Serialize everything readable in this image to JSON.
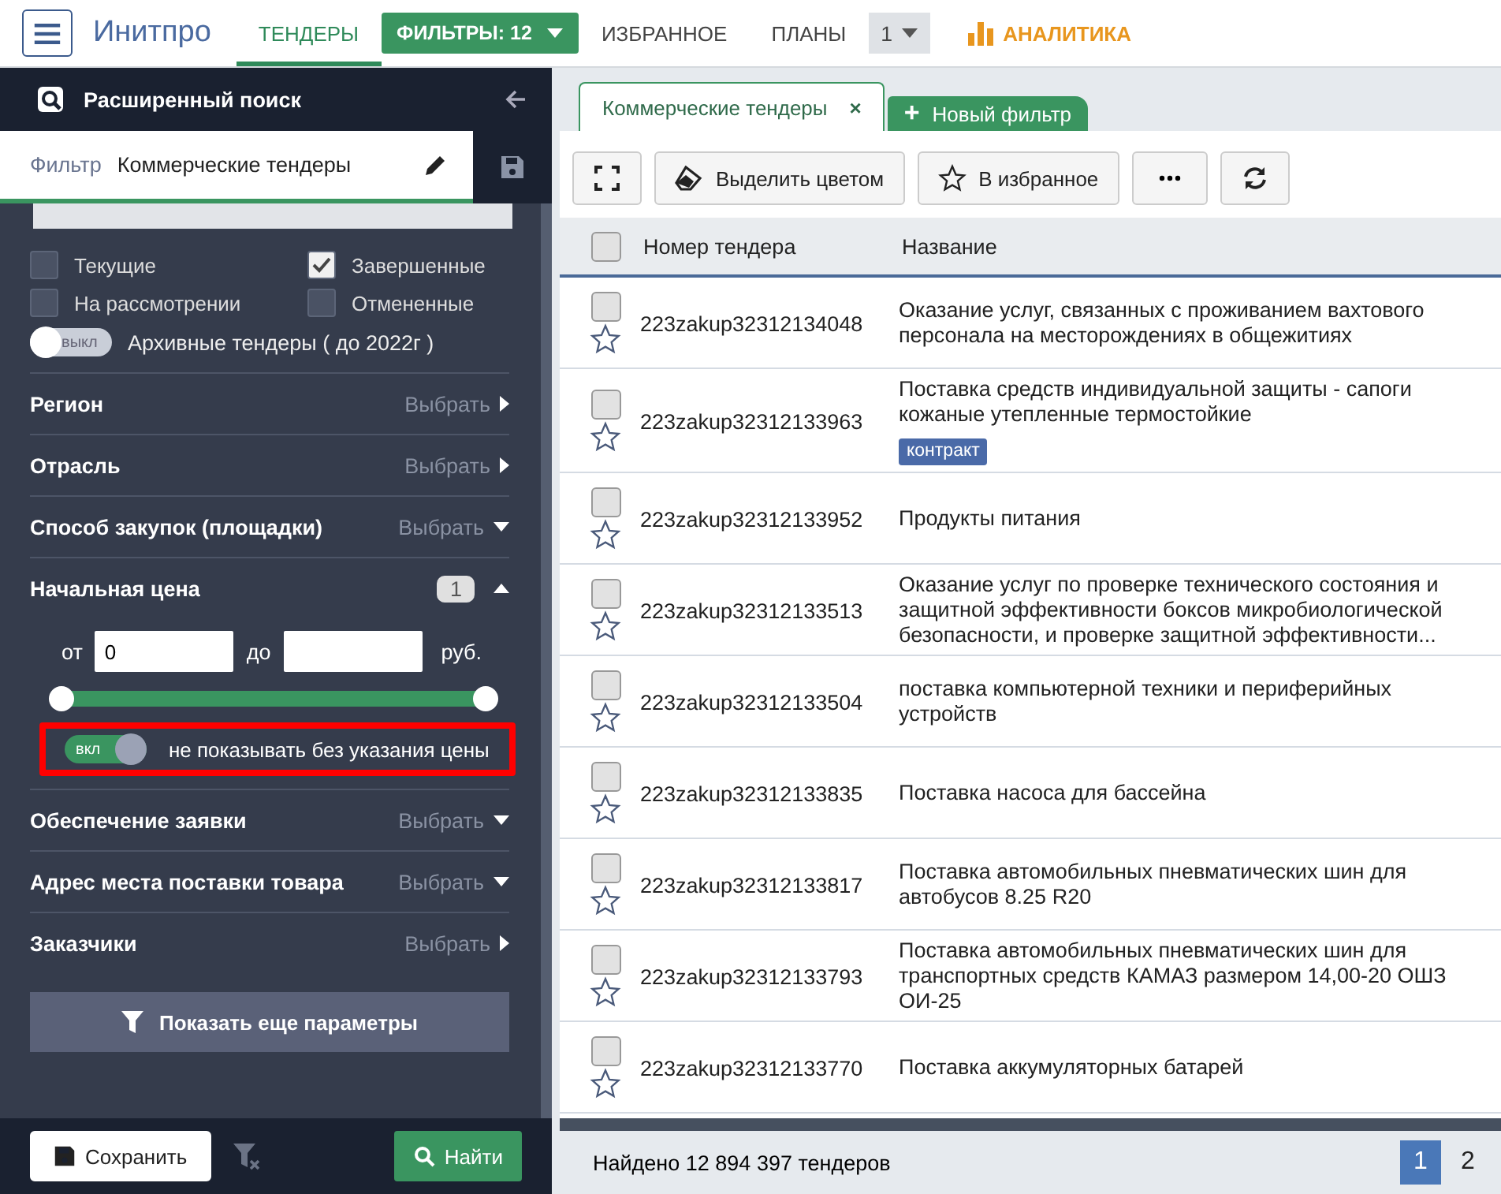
{
  "topbar": {
    "logo": "Инитпро",
    "nav": [
      {
        "kind": "tab",
        "label": "ТЕНДЕРЫ",
        "selected": true
      },
      {
        "kind": "dropdown",
        "label": "ФИЛЬТРЫ: 12",
        "selected": false
      },
      {
        "kind": "tab",
        "label": "ИЗБРАННОЕ",
        "selected": false
      },
      {
        "kind": "tab",
        "label": "ПЛАНЫ",
        "selected": false
      },
      {
        "kind": "select",
        "label": "1",
        "selected": false
      },
      {
        "kind": "analytics",
        "label": "АНАЛИТИКА",
        "selected": false
      }
    ]
  },
  "sidebar": {
    "title": "Расширенный поиск",
    "filter_label": "Фильтр",
    "filter_name": "Коммерческие тендеры",
    "statuses": [
      {
        "label": "Текущие",
        "checked": false
      },
      {
        "label": "Завершенные",
        "checked": true
      },
      {
        "label": "На рассмотрении",
        "checked": false
      },
      {
        "label": "Отмененные",
        "checked": false
      }
    ],
    "archive_toggle": {
      "state_text": "выкл",
      "label": "Архивные тендеры ( до 2022г )",
      "on": false
    },
    "sections": [
      {
        "label": "Регион",
        "action": "Выбрать",
        "expanded": false
      },
      {
        "label": "Отрасль",
        "action": "Выбрать",
        "expanded": false
      },
      {
        "label": "Способ закупок (площадки)",
        "action": "Выбрать",
        "expanded": true
      }
    ],
    "price": {
      "label": "Начальная цена",
      "count": "1",
      "expanded": true,
      "from_label": "от",
      "from_value": "0",
      "to_label": "до",
      "currency": "руб.",
      "level": 1,
      "no_price_toggle": {
        "state_text": "вкл",
        "label": "не показывать без указания цены",
        "on": true
      }
    },
    "sections_after": [
      {
        "label": "Обеспечение заявки",
        "action": "Выбрать",
        "expanded": true
      },
      {
        "label": "Адрес места поставки товара",
        "action": "Выбрать",
        "expanded": true
      },
      {
        "label": "Заказчики",
        "action": "Выбрать",
        "expanded": false
      }
    ],
    "more_button": "Показать еще параметры",
    "save_button": "Сохранить",
    "find_button": "Найти"
  },
  "tabs": [
    {
      "label": "Коммерческие тендеры",
      "selected": true,
      "close": "×"
    },
    {
      "label": "Новый фильтр",
      "selected": false,
      "icon": "+"
    }
  ],
  "toolbar": [
    "Выделить цветом",
    "В избранное"
  ],
  "table": {
    "select_all_checked": false,
    "columns": [
      "Номер тендера",
      "Название"
    ],
    "rows": [
      {
        "number": "223zakup32312134048",
        "title": "Оказание услуг, связанных с проживанием вахтового персонала на месторождениях в общежитиях",
        "checked": false,
        "starred": false
      },
      {
        "number": "223zakup32312133963",
        "title": "Поставка средств индивидуальной защиты - сапоги кожаные утепленные термостойкие",
        "tag": "контракт",
        "checked": false,
        "starred": false
      },
      {
        "number": "223zakup32312133952",
        "title": "Продукты питания",
        "checked": false,
        "starred": false
      },
      {
        "number": "223zakup32312133513",
        "title": "Оказание услуг по проверке технического состояния и защитной эффективности боксов микробиологической безопасности, и проверке защитной эффективности...",
        "checked": false,
        "starred": false
      },
      {
        "number": "223zakup32312133504",
        "title": "поставка компьютерной техники и периферийных устройств",
        "checked": false,
        "starred": false
      },
      {
        "number": "223zakup32312133835",
        "title": "Поставка насоса для бассейна",
        "checked": false,
        "starred": false
      },
      {
        "number": "223zakup32312133817",
        "title": "Поставка автомобильных пневматических шин для автобусов 8.25 R20",
        "checked": false,
        "starred": false
      },
      {
        "number": "223zakup32312133793",
        "title": "Поставка автомобильных пневматических шин для транспортных средств КАМАЗ размером 14,00-20 ОШЗ ОИ-25",
        "checked": false,
        "starred": false
      },
      {
        "number": "223zakup32312133770",
        "title": "Поставка аккумуляторных батарей",
        "checked": false,
        "starred": false
      }
    ]
  },
  "status_bar": {
    "found": "Найдено 12 894 397 тендеров",
    "pages": [
      {
        "label": "1",
        "selected": true
      },
      {
        "label": "2",
        "selected": false
      }
    ]
  }
}
